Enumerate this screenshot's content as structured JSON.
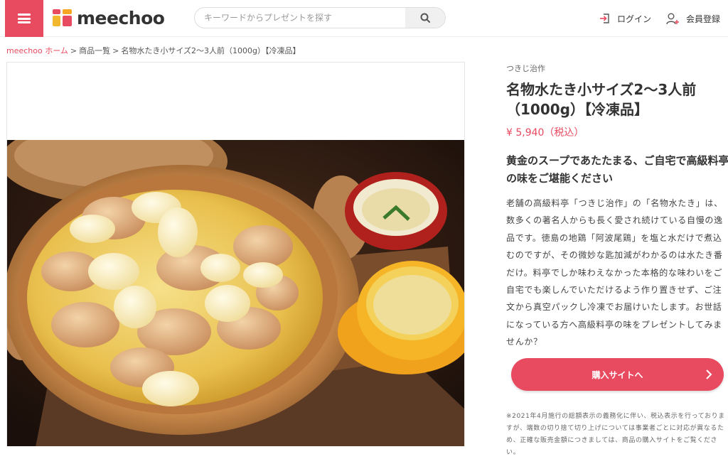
{
  "header": {
    "logo_text": "meechoo",
    "search_placeholder": "キーワードからプレゼントを探す",
    "login_label": "ログイン",
    "register_label": "会員登録"
  },
  "breadcrumb": {
    "home": "meechoo ホーム",
    "list": "商品一覧",
    "current": "名物水たき小サイズ2〜3人前（1000g）【冷凍品】"
  },
  "product": {
    "brand": "つきじ治作",
    "title": "名物水たき小サイズ2〜3人前（1000g）【冷凍品】",
    "price": "¥ 5,940（税込）",
    "catch_copy": "黄金のスープであたたまる、ご自宅で高級料亭の味をご堪能ください",
    "description": "老舗の高級料亭「つきじ治作」の「名物水たき」は、数多くの著名人からも長く愛され続けている自慢の逸品です。徳島の地鶏「阿波尾鶏」を塩と水だけで煮込むのですが、その微妙な匙加減がわかるのは水たき番だけ。料亭でしか味わえなかった本格的な味わいをご自宅でも楽しんでいただけるよう作り置きせず、ご注文から真空パックし冷凍でお届けいたします。お世話になっている方へ高級料亭の味をプレゼントしてみませんか？",
    "buy_label": "購入サイトへ",
    "note": "※2021年4月施行の総額表示の義務化に伴い、税込表示を行っておりますが、端数の切り捨て切り上げについては事業者ごとに対応が異なるため、正確な販売金額につきましては、商品の購入サイトをご覧ください。"
  },
  "colors": {
    "accent": "#e84a5f"
  }
}
